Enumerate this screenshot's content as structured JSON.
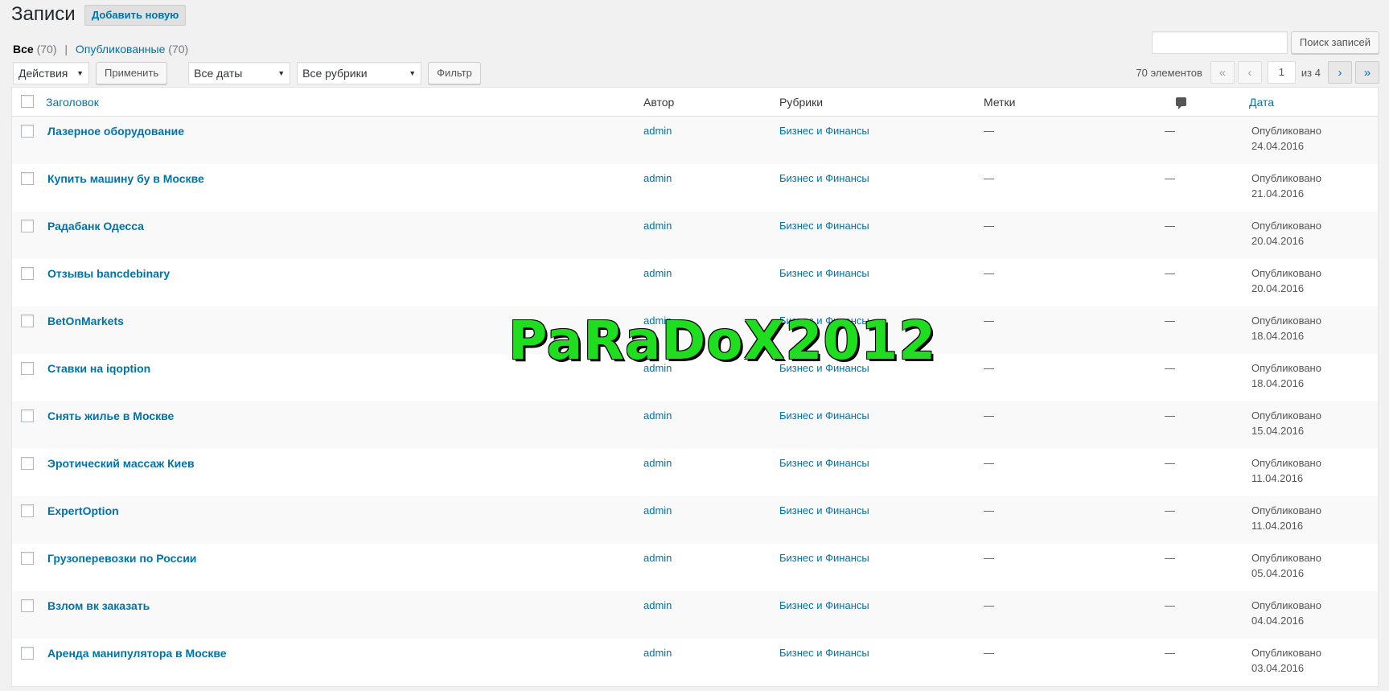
{
  "header": {
    "title": "Записи",
    "add_new": "Добавить новую"
  },
  "filters": {
    "all_label": "Все",
    "all_count": "(70)",
    "separator": "|",
    "published_label": "Опубликованные",
    "published_count": "(70)"
  },
  "search": {
    "value": "",
    "button": "Поиск записей"
  },
  "tablenav": {
    "bulk_action": "Действия",
    "apply": "Применить",
    "dates": "Все даты",
    "categories": "Все рубрики",
    "filter": "Фильтр"
  },
  "pagination": {
    "items": "70 элементов",
    "first": "«",
    "prev": "‹",
    "current_page": "1",
    "of": "из 4",
    "next": "›",
    "last": "»"
  },
  "columns": {
    "title": "Заголовок",
    "author": "Автор",
    "categories": "Рубрики",
    "tags": "Метки",
    "comments_icon": "comment-bubble-icon",
    "date": "Дата"
  },
  "rows": [
    {
      "title": "Лазерное оборудование",
      "author": "admin",
      "category": "Бизнес и Финансы",
      "tags": "—",
      "comments": "—",
      "status": "Опубликовано",
      "date": "24.04.2016"
    },
    {
      "title": "Купить машину бу в Москве",
      "author": "admin",
      "category": "Бизнес и Финансы",
      "tags": "—",
      "comments": "—",
      "status": "Опубликовано",
      "date": "21.04.2016"
    },
    {
      "title": "Радабанк Одесса",
      "author": "admin",
      "category": "Бизнес и Финансы",
      "tags": "—",
      "comments": "—",
      "status": "Опубликовано",
      "date": "20.04.2016"
    },
    {
      "title": "Отзывы bancdebinary",
      "author": "admin",
      "category": "Бизнес и Финансы",
      "tags": "—",
      "comments": "—",
      "status": "Опубликовано",
      "date": "20.04.2016"
    },
    {
      "title": "BetOnMarkets",
      "author": "admin",
      "category": "Бизнес и Финансы",
      "tags": "—",
      "comments": "—",
      "status": "Опубликовано",
      "date": "18.04.2016"
    },
    {
      "title": "Ставки на iqoption",
      "author": "admin",
      "category": "Бизнес и Финансы",
      "tags": "—",
      "comments": "—",
      "status": "Опубликовано",
      "date": "18.04.2016"
    },
    {
      "title": "Снять жилье в Москве",
      "author": "admin",
      "category": "Бизнес и Финансы",
      "tags": "—",
      "comments": "—",
      "status": "Опубликовано",
      "date": "15.04.2016"
    },
    {
      "title": "Эротический массаж Киев",
      "author": "admin",
      "category": "Бизнес и Финансы",
      "tags": "—",
      "comments": "—",
      "status": "Опубликовано",
      "date": "11.04.2016"
    },
    {
      "title": "ExpertOption",
      "author": "admin",
      "category": "Бизнес и Финансы",
      "tags": "—",
      "comments": "—",
      "status": "Опубликовано",
      "date": "11.04.2016"
    },
    {
      "title": "Грузоперевозки по России",
      "author": "admin",
      "category": "Бизнес и Финансы",
      "tags": "—",
      "comments": "—",
      "status": "Опубликовано",
      "date": "05.04.2016"
    },
    {
      "title": "Взлом вк заказать",
      "author": "admin",
      "category": "Бизнес и Финансы",
      "tags": "—",
      "comments": "—",
      "status": "Опубликовано",
      "date": "04.04.2016"
    },
    {
      "title": "Аренда манипулятора в Москве",
      "author": "admin",
      "category": "Бизнес и Финансы",
      "tags": "—",
      "comments": "—",
      "status": "Опубликовано",
      "date": "03.04.2016"
    }
  ],
  "watermark": "PaRaDoX2012",
  "colors": {
    "link": "#0073aa",
    "watermark": "#1fdd1f",
    "background": "#f1f1f1"
  }
}
